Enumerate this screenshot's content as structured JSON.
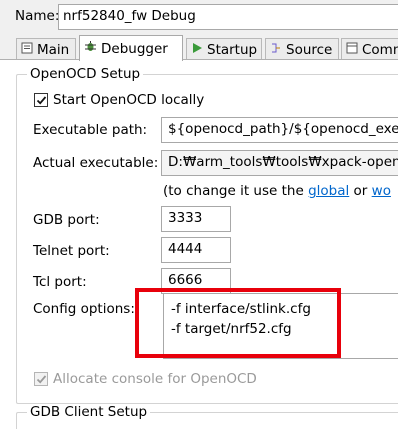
{
  "name_label": "Name:",
  "name_value": "nrf52840_fw Debug",
  "tabs": [
    {
      "label": "Main",
      "icon": "main-icon"
    },
    {
      "label": "Debugger",
      "icon": "debugger-icon"
    },
    {
      "label": "Startup",
      "icon": "startup-icon"
    },
    {
      "label": "Source",
      "icon": "source-icon"
    },
    {
      "label": "Comm",
      "icon": "common-icon"
    }
  ],
  "openocd": {
    "group_title": "OpenOCD Setup",
    "start_label": "Start OpenOCD locally",
    "start_checked": true,
    "exec_label": "Executable path:",
    "exec_value": "${openocd_path}/${openocd_execu",
    "actual_label": "Actual executable:",
    "actual_value": "D:₩arm_tools₩tools₩xpack-openo",
    "hint_prefix": "(to change it use the ",
    "hint_link1": "global",
    "hint_mid": " or ",
    "hint_link2": "wo",
    "gdb_label": "GDB port:",
    "gdb_value": "3333",
    "telnet_label": "Telnet port:",
    "telnet_value": "4444",
    "tcl_label": "Tcl port:",
    "tcl_value": "6666",
    "config_label": "Config options:",
    "config_value": "-f interface/stlink.cfg\n-f target/nrf52.cfg",
    "allocate_label": "Allocate console for OpenOCD",
    "allocate_checked": true
  },
  "gdb_client": {
    "group_title": "GDB Client Setup"
  },
  "colors": {
    "highlight": "#e8000b",
    "link": "#0066cc"
  }
}
